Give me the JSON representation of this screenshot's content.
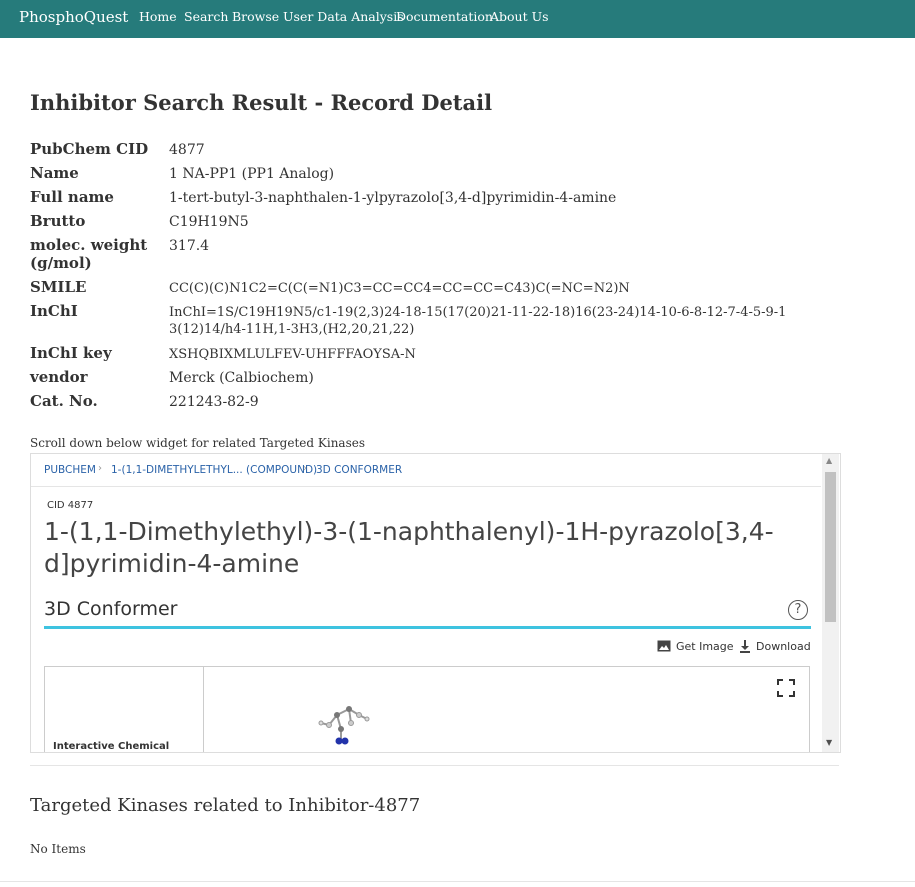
{
  "navbar": {
    "brand": "PhosphoQuest",
    "items": [
      "Home",
      "Search",
      "Browse",
      "User Data Analysis",
      "Documentation",
      "About Us"
    ]
  },
  "page_title": "Inhibitor Search Result - Record Detail",
  "details": [
    {
      "label": "PubChem CID",
      "value": "4877"
    },
    {
      "label": "Name",
      "value": "1 NA-PP1 (PP1 Analog)"
    },
    {
      "label": "Full name",
      "value": "1-tert-butyl-3-naphthalen-1-ylpyrazolo[3,4-d]pyrimidin-4-amine"
    },
    {
      "label": "Brutto",
      "value": "C19H19N5"
    },
    {
      "label": "molec. weight (g/mol)",
      "value": "317.4"
    },
    {
      "label": "SMILE",
      "value": "CC(C)(C)N1C2=C(C(=N1)C3=CC=CC4=CC=CC=C43)C(=NC=N2)N"
    },
    {
      "label": "InChI",
      "value": "InChI=1S/C19H19N5/c1-19(2,3)24-18-15(17(20)21-11-22-18)16(23-24)14-10-6-8-12-7-4-5-9-13(12)14/h4-11H,1-3H3,(H2,20,21,22)"
    },
    {
      "label": "InChI key",
      "value": "XSHQBIXMLULFEV-UHFFFAOYSA-N"
    },
    {
      "label": "vendor",
      "value": "Merck (Calbiochem)"
    },
    {
      "label": "Cat. No.",
      "value": "221243-82-9"
    }
  ],
  "widget_note": "Scroll down below widget for related Targeted Kinases",
  "widget": {
    "breadcrumbs": [
      "PUBCHEM",
      "1-(1,1-DIMETHYLETHYL... (COMPOUND)",
      "3D CONFORMER"
    ],
    "cid_label": "CID 4877",
    "compound_title": "1-(1,1-Dimethylethyl)-3-(1-naphthalenyl)-1H-pyrazolo[3,4-d]pyrimidin-4-amine",
    "section_title": "3D Conformer",
    "help_glyph": "?",
    "get_image_label": "Get Image",
    "download_label": "Download",
    "viewer_side_label": "Interactive Chemical",
    "accent_color": "#3ec3e0"
  },
  "kinases_title": "Targeted Kinases related to Inhibitor-4877",
  "no_items": "No Items"
}
